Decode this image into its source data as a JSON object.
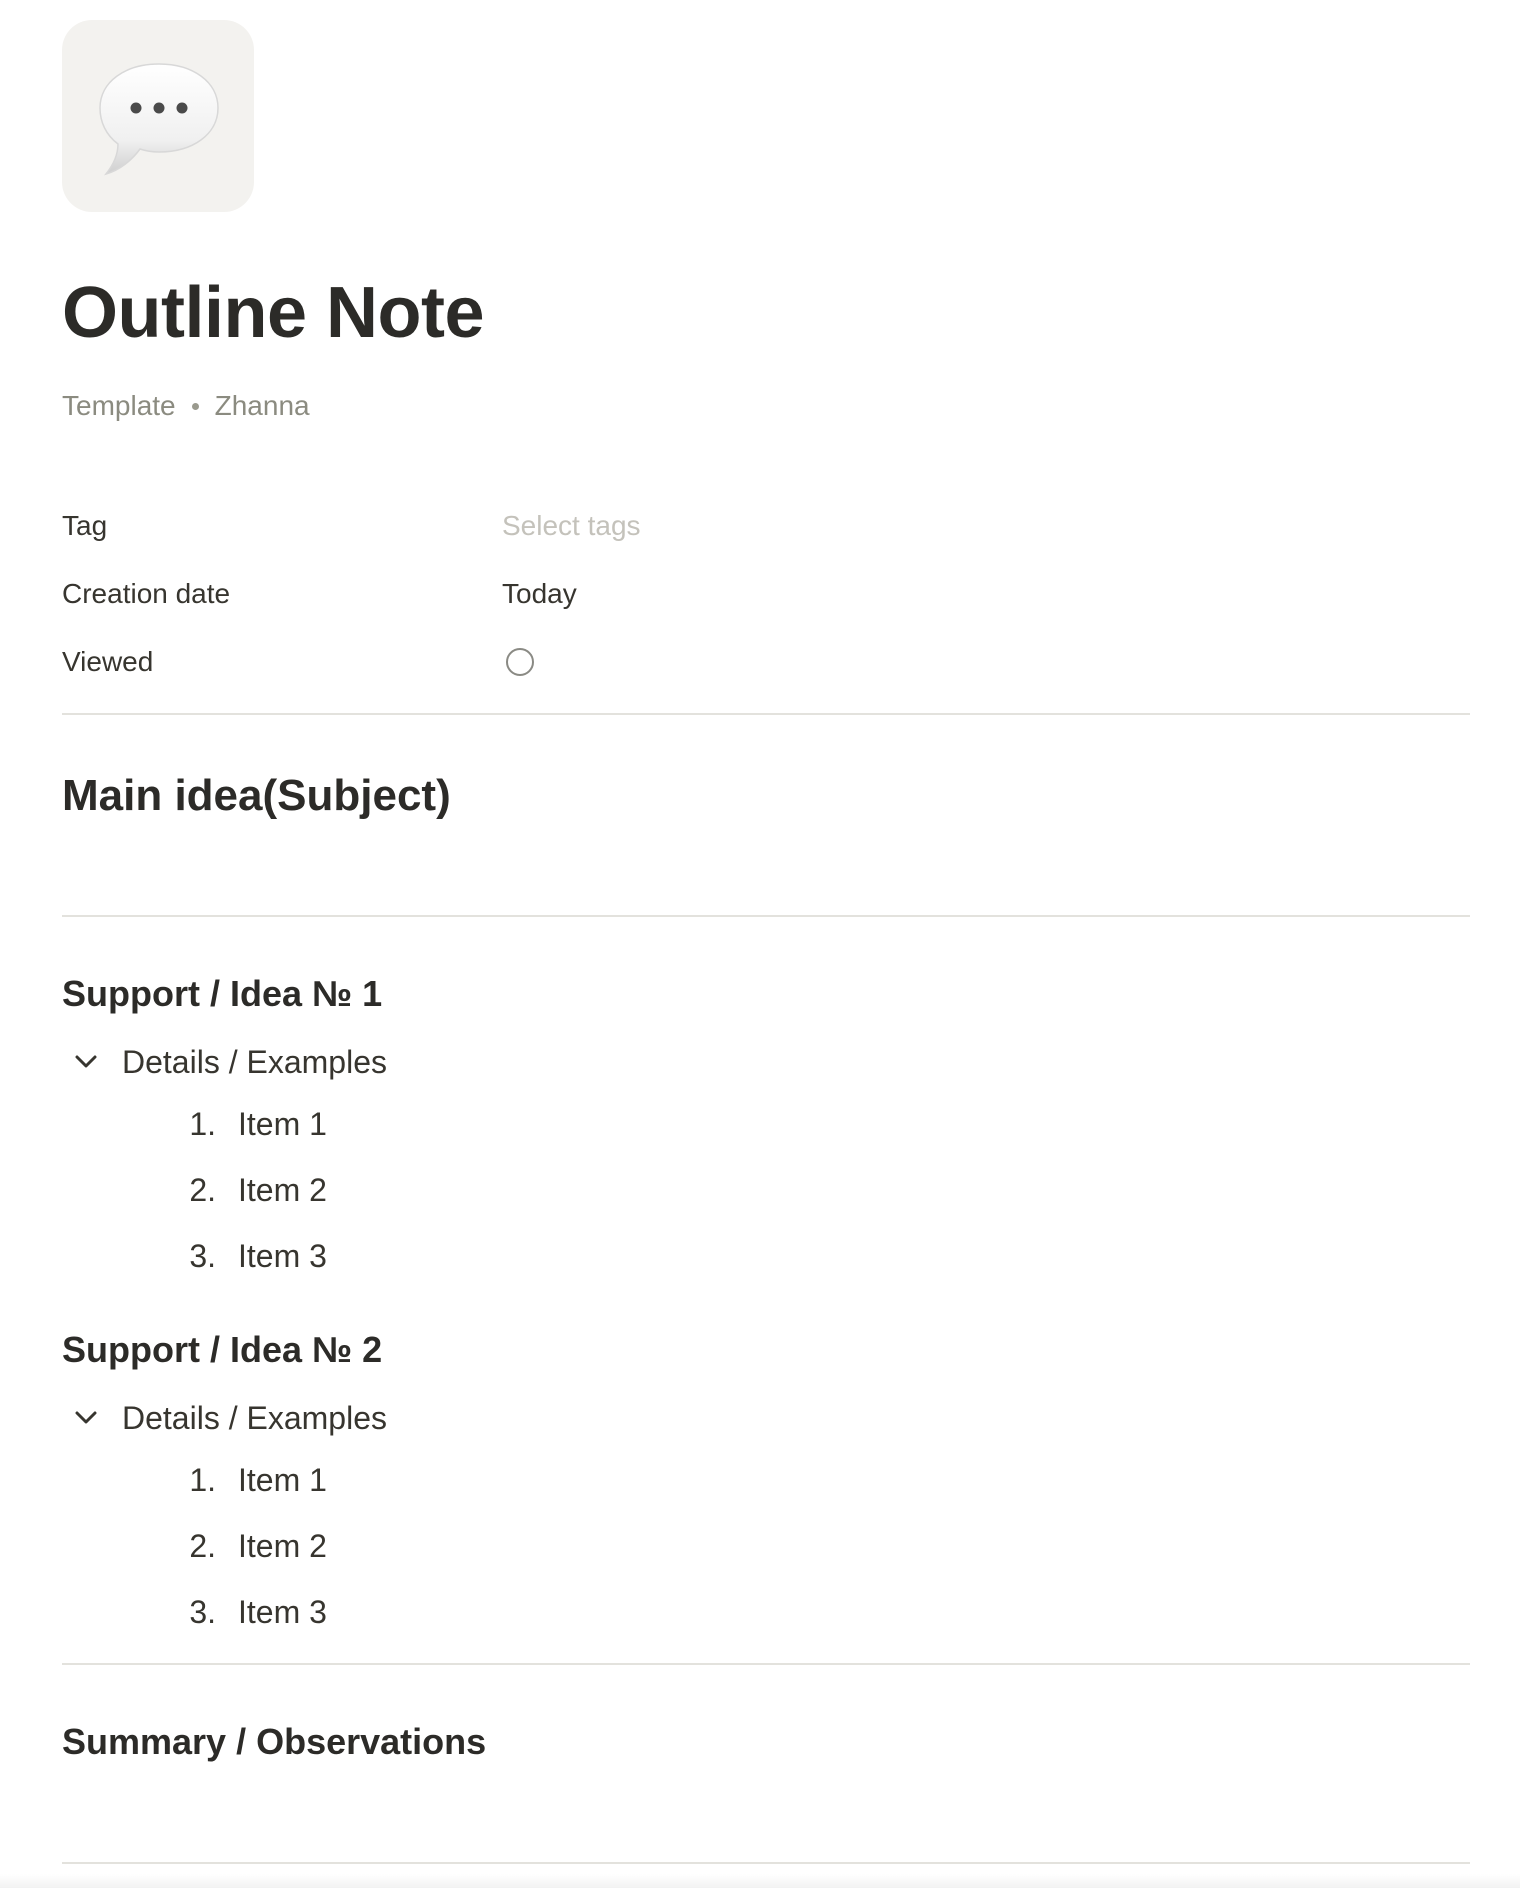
{
  "page": {
    "title": "Outline Note",
    "icon": "speech-bubble-icon",
    "meta": {
      "template": "Template",
      "author": "Zhanna"
    }
  },
  "properties": {
    "tag": {
      "label": "Tag",
      "placeholder": "Select tags"
    },
    "creation_date": {
      "label": "Creation date",
      "value": "Today"
    },
    "viewed": {
      "label": "Viewed",
      "checked": false
    }
  },
  "content": {
    "main_heading": "Main idea(Subject)",
    "sections": [
      {
        "heading": "Support / Idea № 1",
        "toggle_label": "Details / Examples",
        "items": [
          {
            "num": "1.",
            "text": "Item 1"
          },
          {
            "num": "2.",
            "text": "Item 2"
          },
          {
            "num": "3.",
            "text": "Item 3"
          }
        ]
      },
      {
        "heading": "Support / Idea № 2",
        "toggle_label": "Details / Examples",
        "items": [
          {
            "num": "1.",
            "text": "Item 1"
          },
          {
            "num": "2.",
            "text": "Item 2"
          },
          {
            "num": "3.",
            "text": "Item 3"
          }
        ]
      }
    ],
    "summary_heading": "Summary / Observations"
  },
  "colors": {
    "text": "#37352f",
    "muted": "#8b8b80",
    "placeholder": "#c4c2bb",
    "divider": "#e3e2dd",
    "icon_bg": "#f3f2ef"
  }
}
